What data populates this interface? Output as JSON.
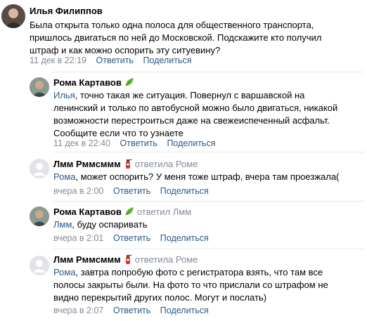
{
  "comments": [
    {
      "author": "Илья Филиппов",
      "lines": [
        "Была открыта только одна полоса для общественного транспорта,",
        "пришлось двигаться по ней до Московской. Подскажите кто получил",
        "штраф и как можно оспорить эту ситуевину?"
      ],
      "date": "11 дек в 22:19",
      "reply_label": "Ответить",
      "share_label": "Поделиться"
    },
    {
      "author": "Рома Картавов",
      "badge_icon": "leaf-icon",
      "mention": "Илья",
      "lines": [
        ", точно такая же ситуация. Повернул с варшавской на",
        "ленинский и только по автобусной можно было двигаться, никакой",
        "возможности перестроиться даже на свежеиспеченный асфальт.",
        "Сообщите если что то узнаете"
      ],
      "date": "11 дек в 22:40",
      "reply_label": "Ответить",
      "share_label": "Поделиться"
    },
    {
      "author": "Лмм Рммсммм",
      "badge_icon": "fire-extinguisher-icon",
      "replied_to": "ответила Роме",
      "mention": "Рома",
      "lines": [
        ", может оспорить? У меня тоже штраф, вчера там проезжала("
      ],
      "date": "вчера в 2:00",
      "reply_label": "Ответить",
      "share_label": "Поделиться"
    },
    {
      "author": "Рома Картавов",
      "badge_icon": "leaf-icon",
      "replied_to": "ответил Лмм",
      "mention": "Лмм",
      "lines": [
        ", буду оспаривать"
      ],
      "date": "вчера в 2:01",
      "reply_label": "Ответить",
      "share_label": "Поделиться"
    },
    {
      "author": "Лмм Рммсммм",
      "badge_icon": "fire-extinguisher-icon",
      "replied_to": "ответила Роме",
      "mention": "Рома",
      "lines": [
        ", завтра попробую фото с регистратора взять, что там все",
        "полосы закрыты были. На фото то что прислали со штрафом не",
        "видно перекрытий других полос. Могут и послать)"
      ],
      "date": "вчера в 2:07",
      "reply_label": "Ответить",
      "share_label": "Поделиться"
    }
  ],
  "colors": {
    "link": "#2a5885",
    "secondary": "#818c99",
    "text": "#000000",
    "divider": "#e7e8ec"
  }
}
